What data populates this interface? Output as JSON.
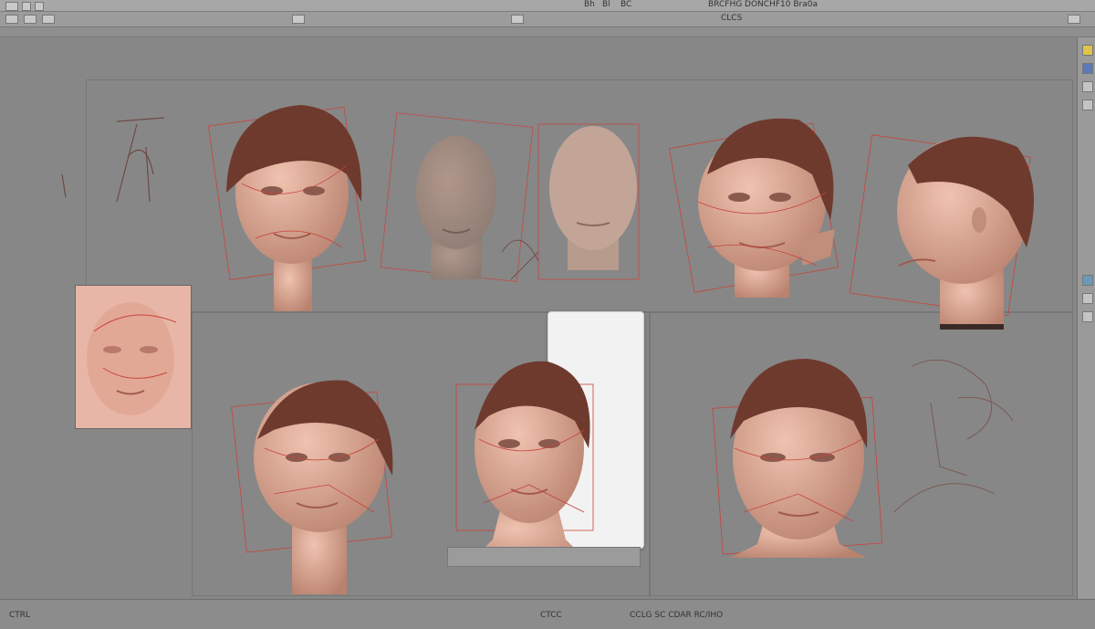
{
  "topbar": {
    "menu_labels": [
      "Bh",
      "Bl",
      "BC"
    ],
    "right_label": "BRCFHG DONCHF10 Bra0a"
  },
  "toolbar": {
    "right_label": "CLCS"
  },
  "status": {
    "left_label": "CTRL",
    "right_label": "CCLG SC CDAR RC/IHO",
    "center_label": "CTCC"
  },
  "viewport": {
    "head_count": 9,
    "colors": {
      "skin": "#dba58f",
      "hair": "#6f3a2e",
      "wire": "#c8443a",
      "background": "#878787"
    }
  }
}
